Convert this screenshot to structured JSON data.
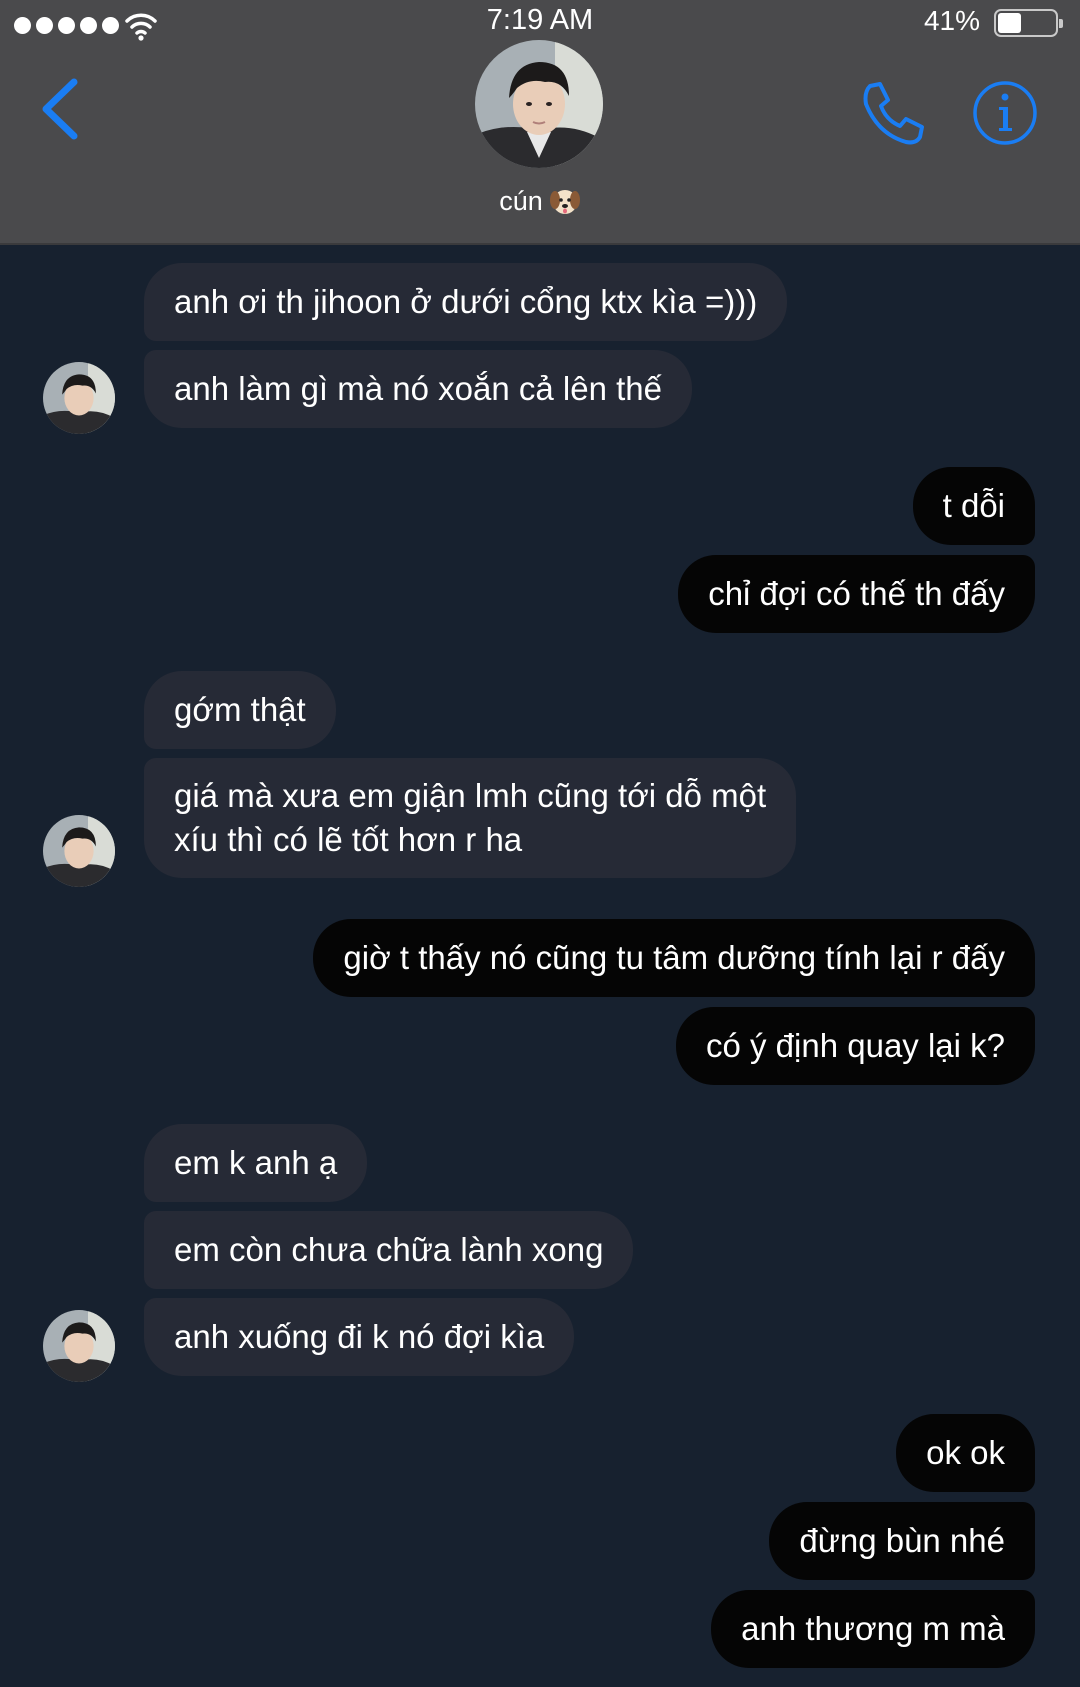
{
  "status_bar": {
    "time": "7:19 AM",
    "battery_percent": "41%",
    "battery_level": 0.41,
    "signal_bars": 5,
    "wifi_icon": "wifi-icon"
  },
  "header": {
    "contact_name": "cún",
    "contact_emoji": "dog-face-icon",
    "back_icon": "chevron-left-icon",
    "call_icon": "phone-icon",
    "info_icon": "info-icon",
    "accent_color": "#1a7df3"
  },
  "messages": [
    {
      "side": "in",
      "text": "anh ơi th jihoon ở dưới cổng ktx kìa =)))"
    },
    {
      "side": "in",
      "text": "anh làm gì mà nó xoắn cả lên thế"
    },
    {
      "side": "out",
      "text": "t dỗi"
    },
    {
      "side": "out",
      "text": "chỉ đợi có thế th đấy"
    },
    {
      "side": "in",
      "text": "gớm thật"
    },
    {
      "side": "in",
      "text_line1": "giá mà xưa em giận lmh cũng tới dỗ một",
      "text_line2": "xíu thì có lẽ tốt hơn r ha"
    },
    {
      "side": "out",
      "text": "giờ t thấy nó cũng tu tâm dưỡng tính lại r đấy"
    },
    {
      "side": "out",
      "text": "có ý định quay lại k?"
    },
    {
      "side": "in",
      "text": "em k anh ạ"
    },
    {
      "side": "in",
      "text": "em còn chưa chữa lành xong"
    },
    {
      "side": "in",
      "text": "anh xuống đi k nó đợi kìa"
    },
    {
      "side": "out",
      "text": "ok ok"
    },
    {
      "side": "out",
      "text": "đừng bùn nhé"
    },
    {
      "side": "out",
      "text": "anh thương m mà"
    }
  ],
  "colors": {
    "background": "#17212f",
    "header": "#4a4a4c",
    "incoming_bubble": "#262a36",
    "outgoing_bubble": "#050505"
  }
}
